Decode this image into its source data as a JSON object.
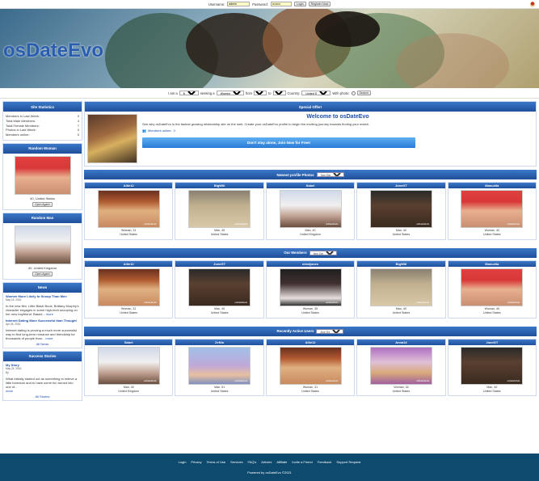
{
  "login": {
    "username_label": "Username:",
    "username_value": "admin",
    "password_label": "Password:",
    "password_value": "••••••••",
    "login_button": "Login",
    "register_button": "Register Now"
  },
  "banner": {
    "logo": "osDateEvo"
  },
  "search": {
    "iam_label": "I am a",
    "iam_value": "Man",
    "seeking_label": "seeking a",
    "seeking_value": "Women",
    "from_label": "from",
    "from_value": "18",
    "to_label": "to",
    "to_value": "50",
    "country_label": "Country:",
    "country_value": "United States",
    "photo_label": "With photo:",
    "search_button": "Search"
  },
  "site_statistics": {
    "title": "Site Statistics",
    "rows": [
      {
        "label": "Members in Last Week:",
        "value": "0"
      },
      {
        "label": "Total Male Members:",
        "value": "4"
      },
      {
        "label": "Total Female Members:",
        "value": "7"
      },
      {
        "label": "Photos in Last Week:",
        "value": "0"
      },
      {
        "label": "Members online:",
        "value": "0"
      }
    ]
  },
  "random_woman": {
    "title": "Random Woman",
    "location": "40, United States",
    "button": "Open Again!"
  },
  "random_man": {
    "title": "Random Man",
    "location": "40, United Kingdom",
    "button": "Open Again!"
  },
  "news": {
    "title": "News",
    "items": [
      {
        "headline": "Women More Likely to Snoop Than Men",
        "date": "May 19, 2016",
        "text": "In the new film, Little Black Book, Brittany Murphy's character engages in some high-tech snooping on her new boyfriend. Based...",
        "more": "more"
      },
      {
        "headline": "Internet Dating More Successful than Thought",
        "date": "Apr 26, 2016",
        "text": "Internet dating is proving a much more successful way to find long-term romance and friendship for thousands of people than...",
        "more": "more"
      }
    ],
    "all": "All News"
  },
  "success_stories": {
    "title": "Success Stories",
    "items": [
      {
        "headline": "My Story",
        "date": "May 24, 2016",
        "by": "By",
        "text": "What initially started out as something to relieve a little boredom and to have some fun turned into one of...",
        "more": "more"
      }
    ],
    "all": "All Stories"
  },
  "special_offer": {
    "title": "Special Offer!",
    "welcome_title": "Welcome to osDateEvo",
    "welcome_text": "See why osDateEvo is the fastest growing relationship site on the web. Create your osDateEvo profile to begin the exciting journey towards finding your match.",
    "online_label": "Members online:",
    "online_value": "0",
    "join_button": "Don't stay alone, Join Now for Free!"
  },
  "newest_photos": {
    "title": "Newest profile Photos",
    "filter": "Any Gender",
    "cards": [
      {
        "name": "Allie12",
        "info": "Woman, 31",
        "country": "United States"
      },
      {
        "name": "BigWill",
        "info": "Man, 40",
        "country": "United States"
      },
      {
        "name": "Sabel",
        "info": "Man, 40",
        "country": "United Kingdom"
      },
      {
        "name": "JoneGT",
        "info": "Man, 40",
        "country": "United States"
      },
      {
        "name": "Manuella",
        "info": "Woman, 40",
        "country": "United States"
      }
    ]
  },
  "our_members": {
    "title": "Our Members",
    "filter": "Any Gender",
    "cards": [
      {
        "name": "Allie12",
        "info": "Woman, 31",
        "country": "United States"
      },
      {
        "name": "JoneGT",
        "info": "Man, 40",
        "country": "United States"
      },
      {
        "name": "mindjones",
        "info": "Woman, 35",
        "country": "United States"
      },
      {
        "name": "BigWill",
        "info": "Man, 40",
        "country": "United States"
      },
      {
        "name": "Manuella",
        "info": "Woman, 40",
        "country": "United States"
      }
    ]
  },
  "recent_users": {
    "title": "Recently Active Users",
    "filter": "Any Gender",
    "cards": [
      {
        "name": "Sabel",
        "info": "Man, 40",
        "country": "United Kingdom"
      },
      {
        "name": "ZeNio",
        "info": "Man, 51",
        "country": "United States"
      },
      {
        "name": "Allie12",
        "info": "Woman, 31",
        "country": "United States"
      },
      {
        "name": "Anna14",
        "info": "Woman, 34",
        "country": "United States"
      },
      {
        "name": "JoneGT",
        "info": "Man, 40",
        "country": "United States"
      }
    ]
  },
  "watermark": "osDateMods",
  "footer": {
    "links": [
      "Login",
      "Privacy",
      "Terms of Use",
      "Services",
      "FAQ's",
      "Articles",
      "Affiliate",
      "Invite a Friend",
      "Feedback",
      "Support Request"
    ],
    "powered": "Powered by osDateEvo ©2021"
  }
}
